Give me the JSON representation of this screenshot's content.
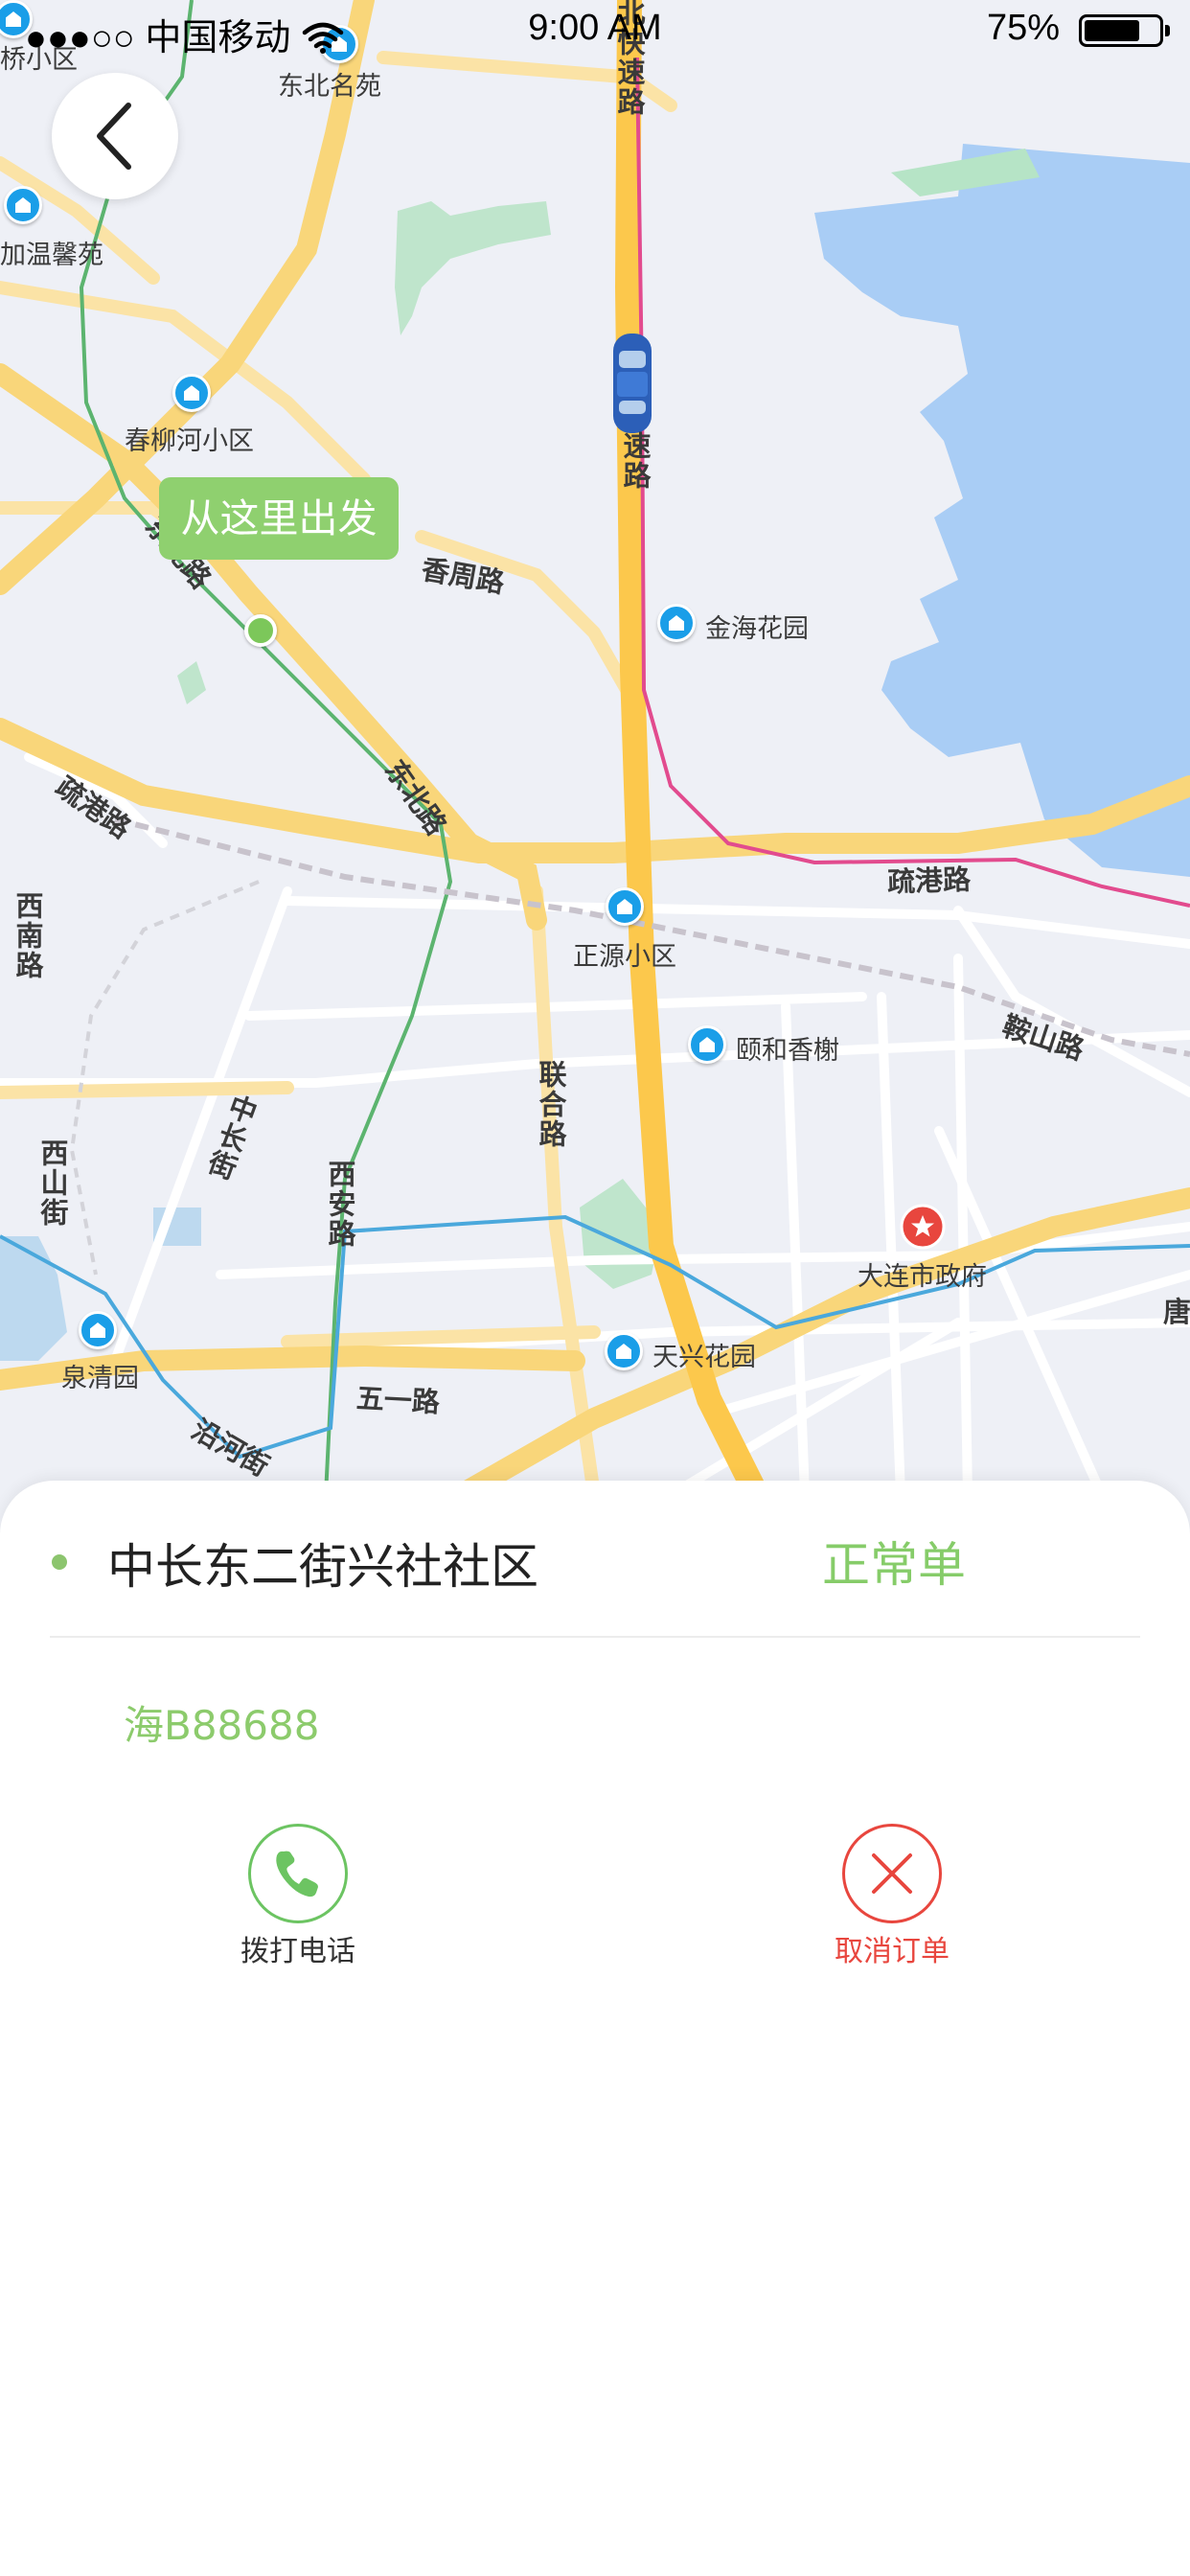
{
  "status_bar": {
    "carrier": "●●●○○ 中国移动",
    "time": "9:00 AM",
    "battery_percent": "75%",
    "battery_level": 0.75
  },
  "map": {
    "start_bubble_label": "从这里出发",
    "pois": [
      {
        "name": "东北名苑"
      },
      {
        "name": "加温馨苑"
      },
      {
        "name": "春柳河小区"
      },
      {
        "name": "金海花园"
      },
      {
        "name": "正源小区"
      },
      {
        "name": "颐和香榭"
      },
      {
        "name": "大连市政府"
      },
      {
        "name": "天兴花园"
      },
      {
        "name": "泉清园"
      },
      {
        "name": "桥小区"
      }
    ],
    "roads": {
      "beiyu_top": "北快速路",
      "express_mid": "速路",
      "xiangzhou": "香周路",
      "shugang_left": "疏港路",
      "dongbei": "东北路",
      "dongbei_partial": "东北路",
      "xinan": "西南路",
      "shugang_right": "疏港路",
      "anshan": "鞍山路",
      "lianhe": "联合路",
      "changjiang_zhong": "中长街",
      "xishan": "西山街",
      "xian": "西安路",
      "wuyi": "五一路",
      "yanhe": "沿河街",
      "tang": "唐"
    }
  },
  "sheet": {
    "destination": "中长东二街兴社社区",
    "order_type": "正常单",
    "plate_number": "海B88688",
    "actions": {
      "call_label": "拨打电话",
      "cancel_label": "取消订单"
    }
  },
  "colors": {
    "accent_green": "#86cc69",
    "cancel_red": "#e8463e",
    "water": "#a9cdf5",
    "road_major": "#f9d67a",
    "metro_pink": "#e24b8e",
    "metro_green": "#5cb46f",
    "metro_blue": "#4aa8dc"
  }
}
